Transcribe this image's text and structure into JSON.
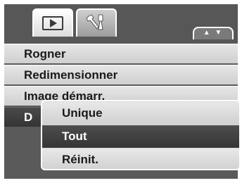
{
  "tabs": [
    {
      "icon": "playback-icon",
      "active": true
    },
    {
      "icon": "setup-tools-icon",
      "active": false
    }
  ],
  "scroll_indicator": {
    "label": "▲ ▼"
  },
  "menu": {
    "items": [
      {
        "label": "Rogner"
      },
      {
        "label": "Redimensionner"
      },
      {
        "label": "Image démarr."
      },
      {
        "label": "D"
      }
    ],
    "selected_index": 3
  },
  "popup": {
    "options": [
      {
        "label": "Unique"
      },
      {
        "label": "Tout"
      },
      {
        "label": "Réinit."
      }
    ],
    "selected_index": 1
  }
}
